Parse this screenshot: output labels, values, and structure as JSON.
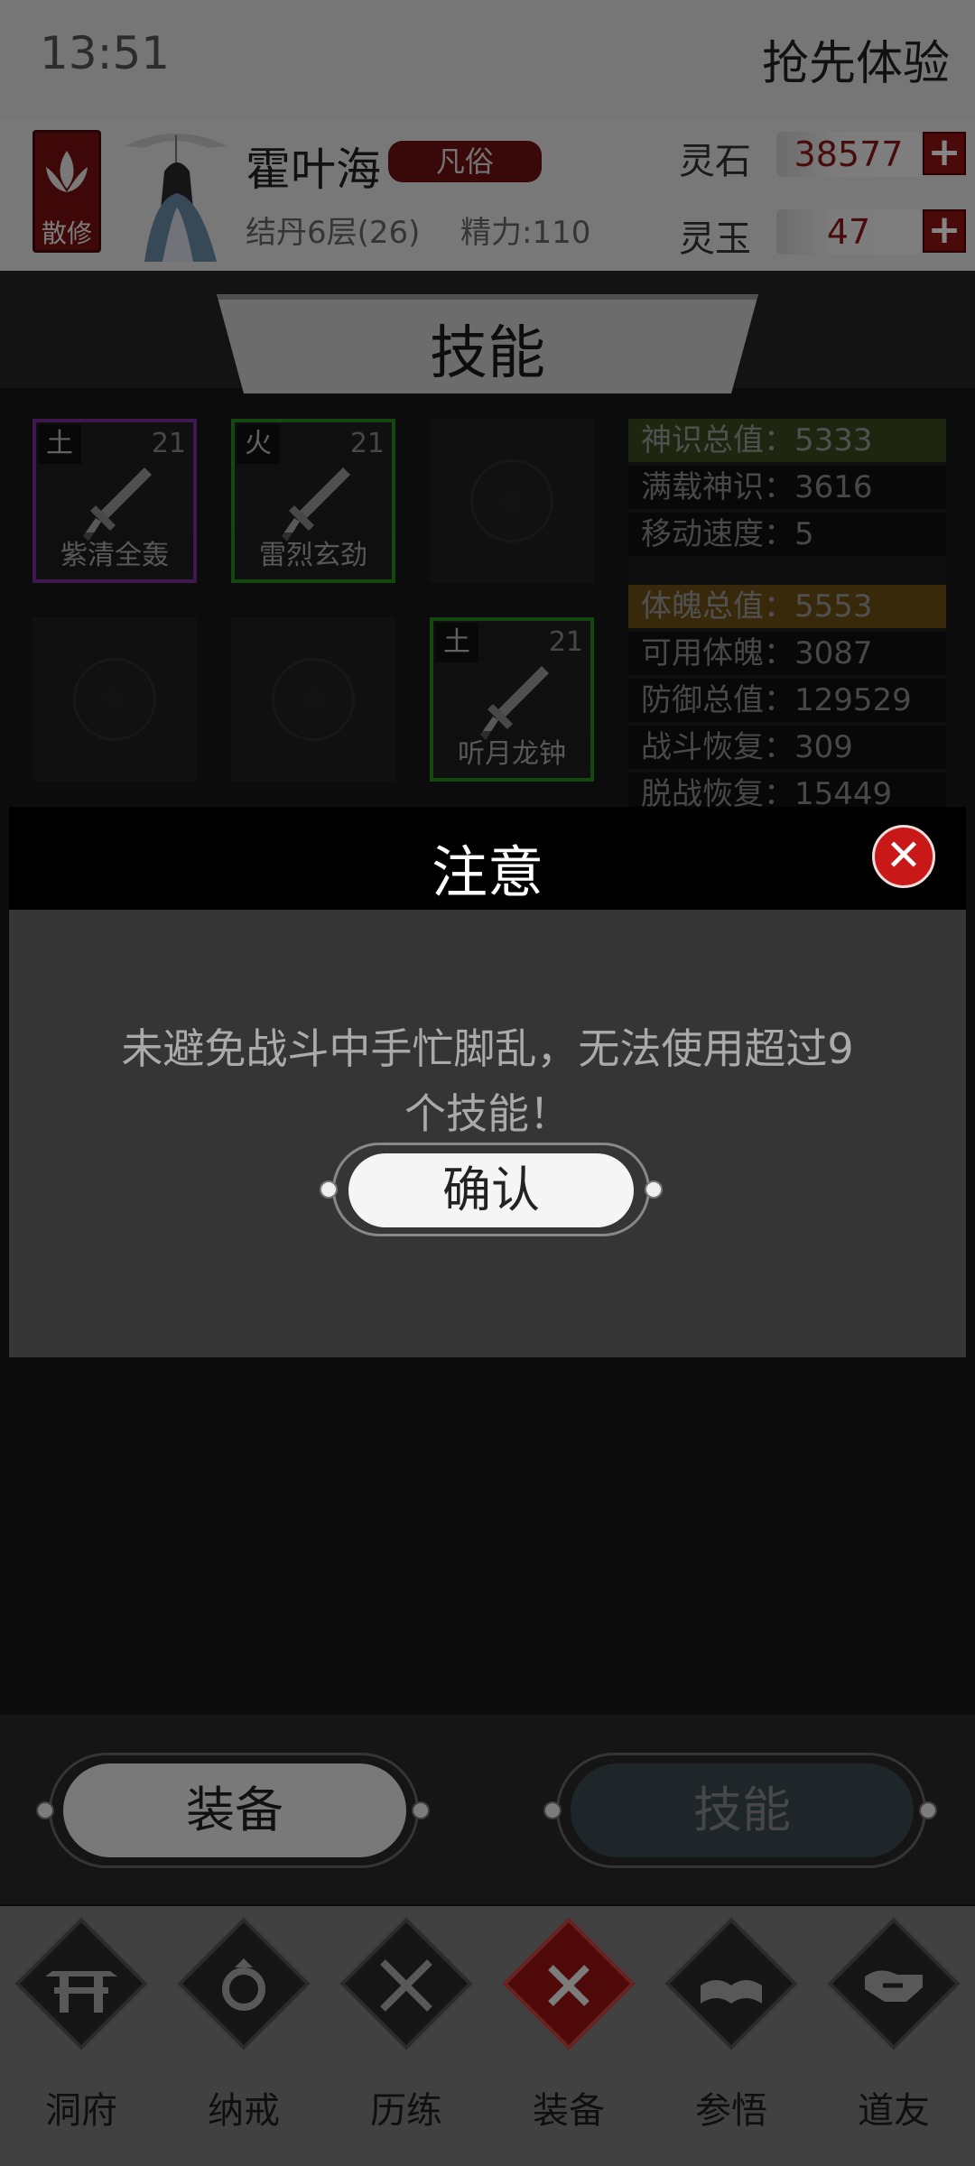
{
  "status_bar": {
    "time": "13:51",
    "preview_label": "抢先体验"
  },
  "player": {
    "sect_badge": "散修",
    "name": "霍叶海",
    "rank": "凡俗",
    "realm": "结丹6层(26)",
    "energy": "精力:110"
  },
  "currencies": [
    {
      "label": "灵石",
      "value": "38577",
      "plus": "+"
    },
    {
      "label": "灵玉",
      "value": "47",
      "plus": "+"
    }
  ],
  "panel_title": "技能",
  "skills": [
    {
      "element": "土",
      "level": "21",
      "name": "紫清全轰",
      "border": "#7c2e9a"
    },
    {
      "element": "火",
      "level": "21",
      "name": "雷烈玄劲",
      "border": "#2a8a1e"
    },
    {
      "element": "土",
      "level": "21",
      "name": "听月龙钟",
      "border": "#2a8a1e"
    }
  ],
  "stats": {
    "spirit_total": "神识总值：5333",
    "full_spirit": "满载神识：3616",
    "move_speed": "移动速度：5",
    "body_total": "体魄总值：5553",
    "usable_body": "可用体魄：3087",
    "defense_total": "防御总值：129529",
    "combat_recovery": "战斗恢复：309",
    "offcombat_recovery": "脱战恢复：15449"
  },
  "modal": {
    "title": "注意",
    "close": "✕",
    "message_line1": "未避免战斗中手忙脚乱，无法使用超过9",
    "message_line2": "个技能！",
    "confirm_label": "确认"
  },
  "toggle_buttons": {
    "equipment": "装备",
    "skills": "技能"
  },
  "bottom_nav": [
    {
      "label": "洞府",
      "icon": "gate-icon"
    },
    {
      "label": "纳戒",
      "icon": "ring-icon"
    },
    {
      "label": "历练",
      "icon": "crossed-swords-icon"
    },
    {
      "label": "装备",
      "icon": "crossed-blades-icon"
    },
    {
      "label": "参悟",
      "icon": "book-icon"
    },
    {
      "label": "道友",
      "icon": "handshake-icon"
    }
  ],
  "colors": {
    "accent_red": "#9a1212",
    "spirit_header": "#3a4a1e",
    "body_header": "#6b5016"
  }
}
